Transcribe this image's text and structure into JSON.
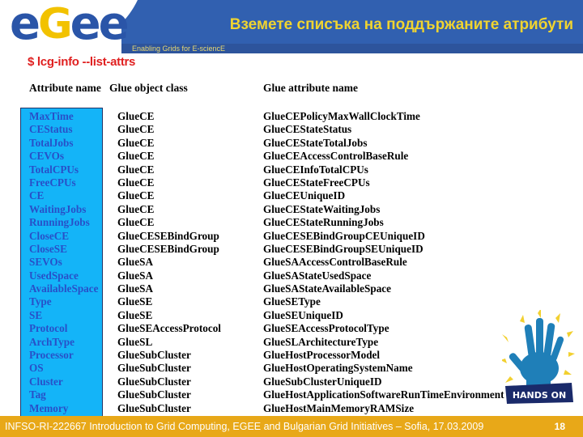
{
  "header": {
    "title": "Вземете списъка на поддържаните атрибути",
    "tagline": "Enabling Grids for E-sciencE",
    "logo_letters": [
      "e",
      "G",
      "e",
      "e"
    ],
    "colors": {
      "band": "#3160b0",
      "title": "#f0d430",
      "logo_blue": "#2a55a8",
      "logo_yellow": "#f2c200"
    }
  },
  "command": "$ lcg-info --list-attrs",
  "table": {
    "headers": {
      "attribute": "Attribute name",
      "object_class": "Glue object class",
      "glue_attribute": "Glue attribute name"
    },
    "rows": [
      {
        "attr": "MaxTime",
        "cls": "GlueCE",
        "glue": "GlueCEPolicyMaxWallClockTime"
      },
      {
        "attr": "CEStatus",
        "cls": "GlueCE",
        "glue": "GlueCEStateStatus"
      },
      {
        "attr": "TotalJobs",
        "cls": "GlueCE",
        "glue": "GlueCEStateTotalJobs"
      },
      {
        "attr": "CEVOs",
        "cls": "GlueCE",
        "glue": "GlueCEAccessControlBaseRule"
      },
      {
        "attr": "TotalCPUs",
        "cls": "GlueCE",
        "glue": "GlueCEInfoTotalCPUs"
      },
      {
        "attr": "FreeCPUs",
        "cls": "GlueCE",
        "glue": "GlueCEStateFreeCPUs"
      },
      {
        "attr": "CE",
        "cls": "GlueCE",
        "glue": "GlueCEUniqueID"
      },
      {
        "attr": "WaitingJobs",
        "cls": "GlueCE",
        "glue": "GlueCEStateWaitingJobs"
      },
      {
        "attr": "RunningJobs",
        "cls": "GlueCE",
        "glue": "GlueCEStateRunningJobs"
      },
      {
        "attr": "CloseCE",
        "cls": "GlueCESEBindGroup",
        "glue": "GlueCESEBindGroupCEUniqueID"
      },
      {
        "attr": "CloseSE",
        "cls": "GlueCESEBindGroup",
        "glue": "GlueCESEBindGroupSEUniqueID"
      },
      {
        "attr": "SEVOs",
        "cls": "GlueSA",
        "glue": "GlueSAAccessControlBaseRule"
      },
      {
        "attr": "UsedSpace",
        "cls": "GlueSA",
        "glue": "GlueSAStateUsedSpace"
      },
      {
        "attr": "AvailableSpace",
        "cls": "GlueSA",
        "glue": "GlueSAStateAvailableSpace"
      },
      {
        "attr": "Type",
        "cls": "GlueSE",
        "glue": "GlueSEType"
      },
      {
        "attr": "SE",
        "cls": "GlueSE",
        "glue": "GlueSEUniqueID"
      },
      {
        "attr": "Protocol",
        "cls": "GlueSEAccessProtocol",
        "glue": "GlueSEAccessProtocolType"
      },
      {
        "attr": "ArchType",
        "cls": "GlueSL",
        "glue": "GlueSLArchitectureType"
      },
      {
        "attr": "Processor",
        "cls": "GlueSubCluster",
        "glue": "GlueHostProcessorModel"
      },
      {
        "attr": "OS",
        "cls": "GlueSubCluster",
        "glue": "GlueHostOperatingSystemName"
      },
      {
        "attr": "Cluster",
        "cls": "GlueSubCluster",
        "glue": "GlueSubClusterUniqueID"
      },
      {
        "attr": "Tag",
        "cls": "GlueSubCluster",
        "glue": "GlueHostApplicationSoftwareRunTimeEnvironment"
      },
      {
        "attr": "Memory",
        "cls": "GlueSubCluster",
        "glue": "GlueHostMainMemoryRAMSize"
      }
    ]
  },
  "badge": {
    "label": "HANDS ON",
    "icon": "hand-icon"
  },
  "footer": {
    "text": "INFSO-RI-222667 Introduction to Grid Computing, EGEE and Bulgarian Grid Initiatives – Sofia, 17.03.2009",
    "page_number": "18",
    "color": "#e8a818"
  }
}
